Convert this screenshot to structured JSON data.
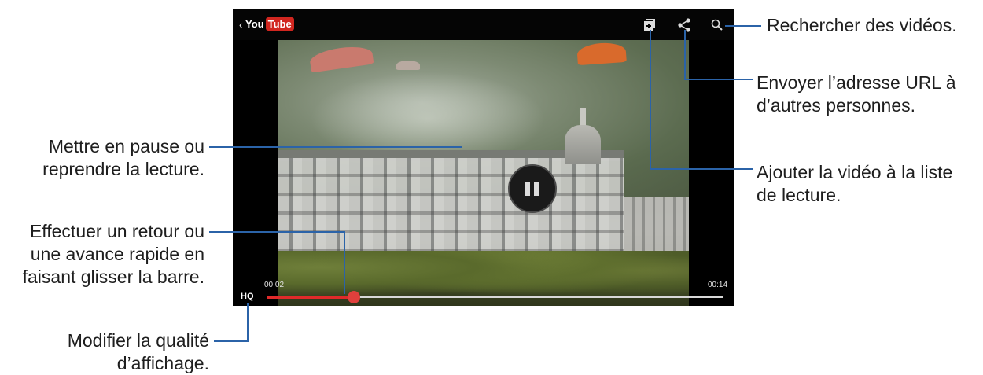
{
  "player": {
    "back_glyph": "‹",
    "logo_you": "You",
    "logo_tube": "Tube",
    "brand_color": "#d1261f",
    "time_elapsed": "00:02",
    "time_total": "00:14",
    "quality_label": "HQ",
    "progress_fraction": 0.19,
    "icons": {
      "playlist": "playlist-add-icon",
      "share": "share-icon",
      "search": "search-icon",
      "pause": "pause-icon"
    }
  },
  "callouts": {
    "search": "Rechercher des vidéos.",
    "share": "Envoyer l’adresse URL à d’autres personnes.",
    "playlist": "Ajouter la vidéo à la liste de lecture.",
    "pause": "Mettre en pause ou reprendre la lecture.",
    "seek": "Effectuer un retour ou une avance rapide en faisant glisser la barre.",
    "quality": "Modifier la qualité d’affichage."
  },
  "accent_line_color": "#2b63a8"
}
